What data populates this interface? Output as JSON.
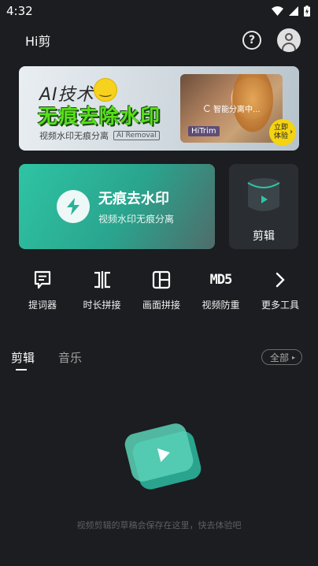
{
  "status_bar": {
    "time": "4:32"
  },
  "app_bar": {
    "title": "Hi剪",
    "help_symbol": "?"
  },
  "banner": {
    "ai_text": "AI技术",
    "headline": "无痕去除水印",
    "subtitle": "视频水印无痕分离",
    "tag": "AI Removal",
    "progress_text": "智能分离中...",
    "brand": "HiTrim",
    "cta": "立即体验"
  },
  "feature_card": {
    "title": "无痕去水印",
    "subtitle": "视频水印无痕分离"
  },
  "edit_card": {
    "label": "剪辑"
  },
  "tools": [
    {
      "label": "提词器",
      "icon": "teleprompter-icon"
    },
    {
      "label": "时长拼接",
      "icon": "duration-join-icon"
    },
    {
      "label": "画面拼接",
      "icon": "screen-join-icon"
    },
    {
      "label": "视频防重",
      "icon": "md5-icon",
      "icon_text": "MD5"
    },
    {
      "label": "更多工具",
      "icon": "chevron-right-icon"
    }
  ],
  "tabs": [
    {
      "label": "剪辑",
      "active": true
    },
    {
      "label": "音乐",
      "active": false
    }
  ],
  "all_button": {
    "label": "全部"
  },
  "empty_state": {
    "text": "视频剪辑的草稿会保存在这里，快去体验吧"
  },
  "colors": {
    "background": "#1b1d20",
    "accent_teal": "#2ec4a4",
    "banner_green": "#58e01a",
    "cta_yellow": "#f4d312"
  }
}
